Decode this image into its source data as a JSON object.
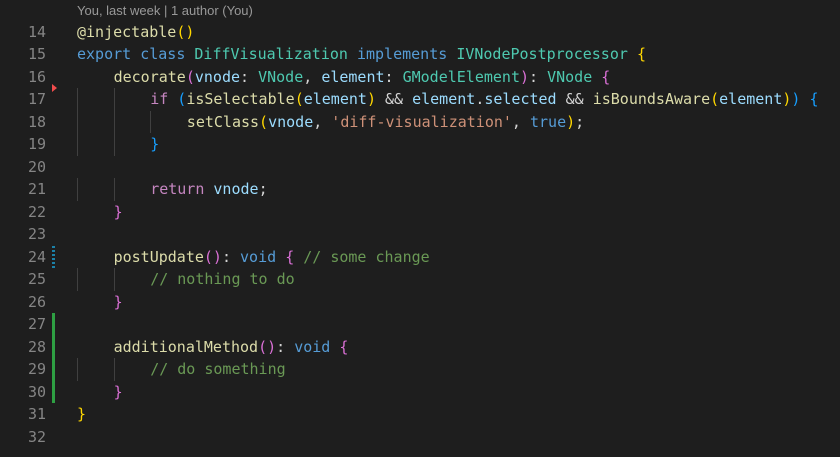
{
  "codelens": "You, last week | 1 author (You)",
  "colors": {
    "background": "#1e1e1e",
    "line_number": "#858585",
    "added": "#2ea043",
    "modified": "#1b81a8",
    "deleted": "#f14c4c"
  },
  "lines": [
    {
      "number": "14",
      "tokens": [
        [
          "fn",
          "@injectable"
        ],
        [
          "b1",
          "()"
        ]
      ]
    },
    {
      "number": "15",
      "tokens": [
        [
          "kw",
          "export"
        ],
        [
          "p",
          " "
        ],
        [
          "kw",
          "class"
        ],
        [
          "p",
          " "
        ],
        [
          "ty",
          "DiffVisualization"
        ],
        [
          "p",
          " "
        ],
        [
          "kw",
          "implements"
        ],
        [
          "p",
          " "
        ],
        [
          "ty",
          "IVNodePostprocessor"
        ],
        [
          "p",
          " "
        ],
        [
          "b1",
          "{"
        ]
      ]
    },
    {
      "number": "16",
      "indent": 1,
      "tokens": [
        [
          "fn",
          "decorate"
        ],
        [
          "b2",
          "("
        ],
        [
          "var",
          "vnode"
        ],
        [
          "p",
          ": "
        ],
        [
          "ty",
          "VNode"
        ],
        [
          "p",
          ", "
        ],
        [
          "var",
          "element"
        ],
        [
          "p",
          ": "
        ],
        [
          "ty",
          "GModelElement"
        ],
        [
          "b2",
          ")"
        ],
        [
          "p",
          ": "
        ],
        [
          "ty",
          "VNode"
        ],
        [
          "p",
          " "
        ],
        [
          "b2",
          "{"
        ]
      ]
    },
    {
      "number": "17",
      "indent": 2,
      "gutter": "deleted",
      "tokens": [
        [
          "ctl",
          "if"
        ],
        [
          "p",
          " "
        ],
        [
          "b3",
          "("
        ],
        [
          "fn",
          "isSelectable"
        ],
        [
          "b1",
          "("
        ],
        [
          "var",
          "element"
        ],
        [
          "b1",
          ")"
        ],
        [
          "p",
          " && "
        ],
        [
          "var",
          "element"
        ],
        [
          "p",
          "."
        ],
        [
          "var",
          "selected"
        ],
        [
          "p",
          " && "
        ],
        [
          "fn",
          "isBoundsAware"
        ],
        [
          "b1",
          "("
        ],
        [
          "var",
          "element"
        ],
        [
          "b1",
          ")"
        ],
        [
          "b3",
          ")"
        ],
        [
          "p",
          " "
        ],
        [
          "b3",
          "{"
        ]
      ]
    },
    {
      "number": "18",
      "indent": 3,
      "tokens": [
        [
          "fn",
          "setClass"
        ],
        [
          "b1",
          "("
        ],
        [
          "var",
          "vnode"
        ],
        [
          "p",
          ", "
        ],
        [
          "str",
          "'diff-visualization'"
        ],
        [
          "p",
          ", "
        ],
        [
          "kw",
          "true"
        ],
        [
          "b1",
          ")"
        ],
        [
          "p",
          ";"
        ]
      ]
    },
    {
      "number": "19",
      "indent": 2,
      "tokens": [
        [
          "b3",
          "}"
        ]
      ]
    },
    {
      "number": "20",
      "tokens": []
    },
    {
      "number": "21",
      "indent": 2,
      "tokens": [
        [
          "ctl",
          "return"
        ],
        [
          "p",
          " "
        ],
        [
          "var",
          "vnode"
        ],
        [
          "p",
          ";"
        ]
      ]
    },
    {
      "number": "22",
      "indent": 1,
      "tokens": [
        [
          "b2",
          "}"
        ]
      ]
    },
    {
      "number": "23",
      "tokens": []
    },
    {
      "number": "24",
      "indent": 1,
      "gutter": "modified",
      "tokens": [
        [
          "fn",
          "postUpdate"
        ],
        [
          "b2",
          "()"
        ],
        [
          "p",
          ": "
        ],
        [
          "kw",
          "void"
        ],
        [
          "p",
          " "
        ],
        [
          "b2",
          "{"
        ],
        [
          "p",
          " "
        ],
        [
          "cm",
          "// some change"
        ]
      ]
    },
    {
      "number": "25",
      "indent": 2,
      "tokens": [
        [
          "cm",
          "// nothing to do"
        ]
      ]
    },
    {
      "number": "26",
      "indent": 1,
      "tokens": [
        [
          "b2",
          "}"
        ]
      ]
    },
    {
      "number": "27",
      "gutter": "added",
      "tokens": []
    },
    {
      "number": "28",
      "indent": 1,
      "gutter": "added",
      "tokens": [
        [
          "fn",
          "additionalMethod"
        ],
        [
          "b2",
          "()"
        ],
        [
          "p",
          ": "
        ],
        [
          "kw",
          "void"
        ],
        [
          "p",
          " "
        ],
        [
          "b2",
          "{"
        ]
      ]
    },
    {
      "number": "29",
      "indent": 2,
      "gutter": "added",
      "tokens": [
        [
          "cm",
          "// do something"
        ]
      ]
    },
    {
      "number": "30",
      "indent": 1,
      "gutter": "added",
      "tokens": [
        [
          "b2",
          "}"
        ]
      ]
    },
    {
      "number": "31",
      "tokens": [
        [
          "b1",
          "}"
        ]
      ]
    },
    {
      "number": "32",
      "tokens": []
    }
  ]
}
